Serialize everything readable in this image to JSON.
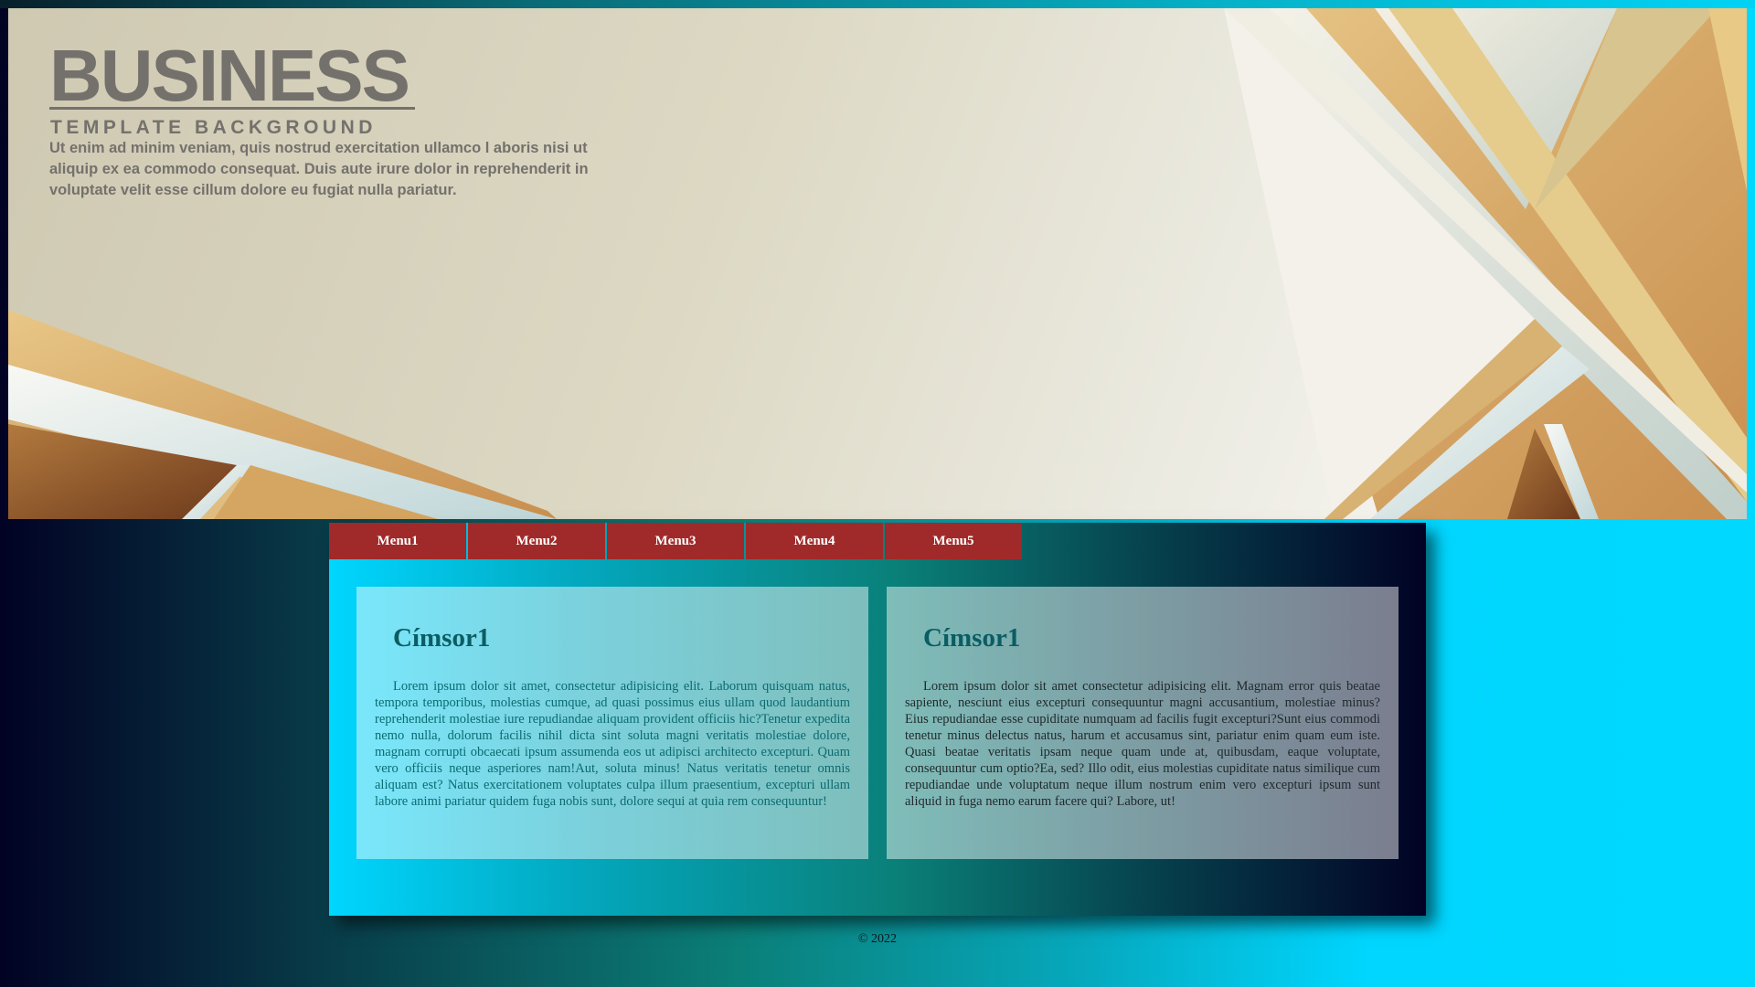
{
  "banner": {
    "title": "BUSINESS",
    "subtitle": "TEMPLATE BACKGROUND",
    "text": "Ut enim ad minim veniam, quis nostrud exercitation ullamco l aboris nisi ut aliquip ex ea commodo consequat. Duis aute irure dolor in reprehenderit in voluptate velit esse cillum dolore eu fugiat nulla pariatur."
  },
  "menu": {
    "items": [
      {
        "label": "Menu1"
      },
      {
        "label": "Menu2"
      },
      {
        "label": "Menu3"
      },
      {
        "label": "Menu4"
      },
      {
        "label": "Menu5"
      }
    ]
  },
  "cards": [
    {
      "heading": "Címsor1",
      "body": "Lorem ipsum dolor sit amet, consectetur adipisicing elit. Laborum quisquam natus, tempora temporibus, molestias cumque, ad quasi possimus eius ullam quod laudantium reprehenderit molestiae iure repudiandae aliquam provident officiis hic?Tenetur expedita nemo nulla, dolorum facilis nihil dicta sint soluta magni veritatis molestiae dolore, magnam corrupti obcaecati ipsum assumenda eos ut adipisci architecto excepturi. Quam vero officiis neque asperiores nam!Aut, soluta minus! Natus veritatis tenetur omnis aliquam est? Natus exercitationem voluptates culpa illum praesentium, excepturi ullam labore animi pariatur quidem fuga nobis sunt, dolore sequi at quia rem consequuntur!"
    },
    {
      "heading": "Címsor1",
      "body": "Lorem ipsum dolor sit amet consectetur adipisicing elit. Magnam error quis beatae sapiente, nesciunt eius excepturi consequuntur magni accusantium, molestiae minus? Eius repudiandae esse cupiditate numquam ad facilis fugit excepturi?Sunt eius commodi tenetur minus delectus natus, harum et accusamus sint, pariatur enim quam eum iste. Quasi beatae veritatis ipsam neque quam unde at, quibusdam, eaque voluptate, consequuntur cum optio?Ea, sed? Illo odit, eius molestias cupiditate natus similique cum repudiandae unde voluptatum neque illum nostrum enim vero excepturi ipsum sunt aliquid in fuga nemo earum facere qui? Labore, ut!"
    }
  ],
  "footer": {
    "text": "© 2022"
  }
}
